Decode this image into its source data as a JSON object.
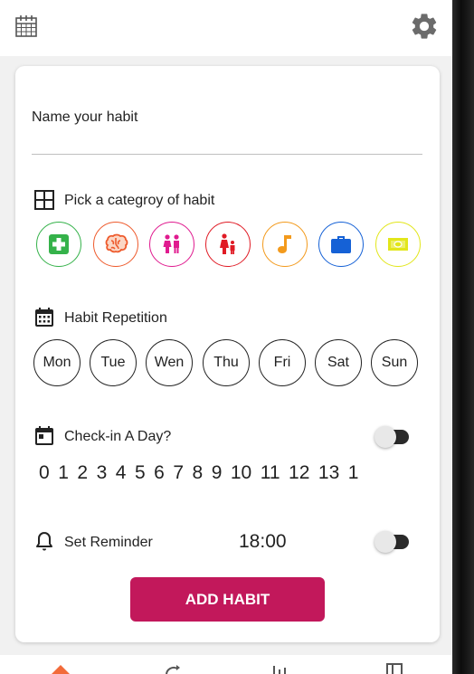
{
  "habit_form": {
    "name_placeholder": "Name your habit",
    "category_label": "Pick a categroy of habit",
    "categories": [
      {
        "icon": "medical-icon",
        "color": "#35b24a"
      },
      {
        "icon": "brain-icon",
        "color": "#ee5a2c"
      },
      {
        "icon": "couple-icon",
        "color": "#e01b8f"
      },
      {
        "icon": "family-icon",
        "color": "#e01b25"
      },
      {
        "icon": "music-note-icon",
        "color": "#f39a1c"
      },
      {
        "icon": "briefcase-icon",
        "color": "#1561d6"
      },
      {
        "icon": "money-icon",
        "color": "#e2e61a"
      }
    ],
    "repetition_label": "Habit Repetition",
    "days": [
      "Mon",
      "Tue",
      "Wen",
      "Thu",
      "Fri",
      "Sat",
      "Sun"
    ],
    "checkin_label": "Check-in A Day?",
    "checkin_numbers": [
      "0",
      "1",
      "2",
      "3",
      "4",
      "5",
      "6",
      "7",
      "8",
      "9",
      "10",
      "11",
      "12",
      "13",
      "1"
    ],
    "reminder_label": "Set Reminder",
    "reminder_time": "18:00",
    "add_button": "ADD HABIT"
  },
  "colors": {
    "accent": "#c2185b",
    "nav_active": "#f26b3a"
  }
}
